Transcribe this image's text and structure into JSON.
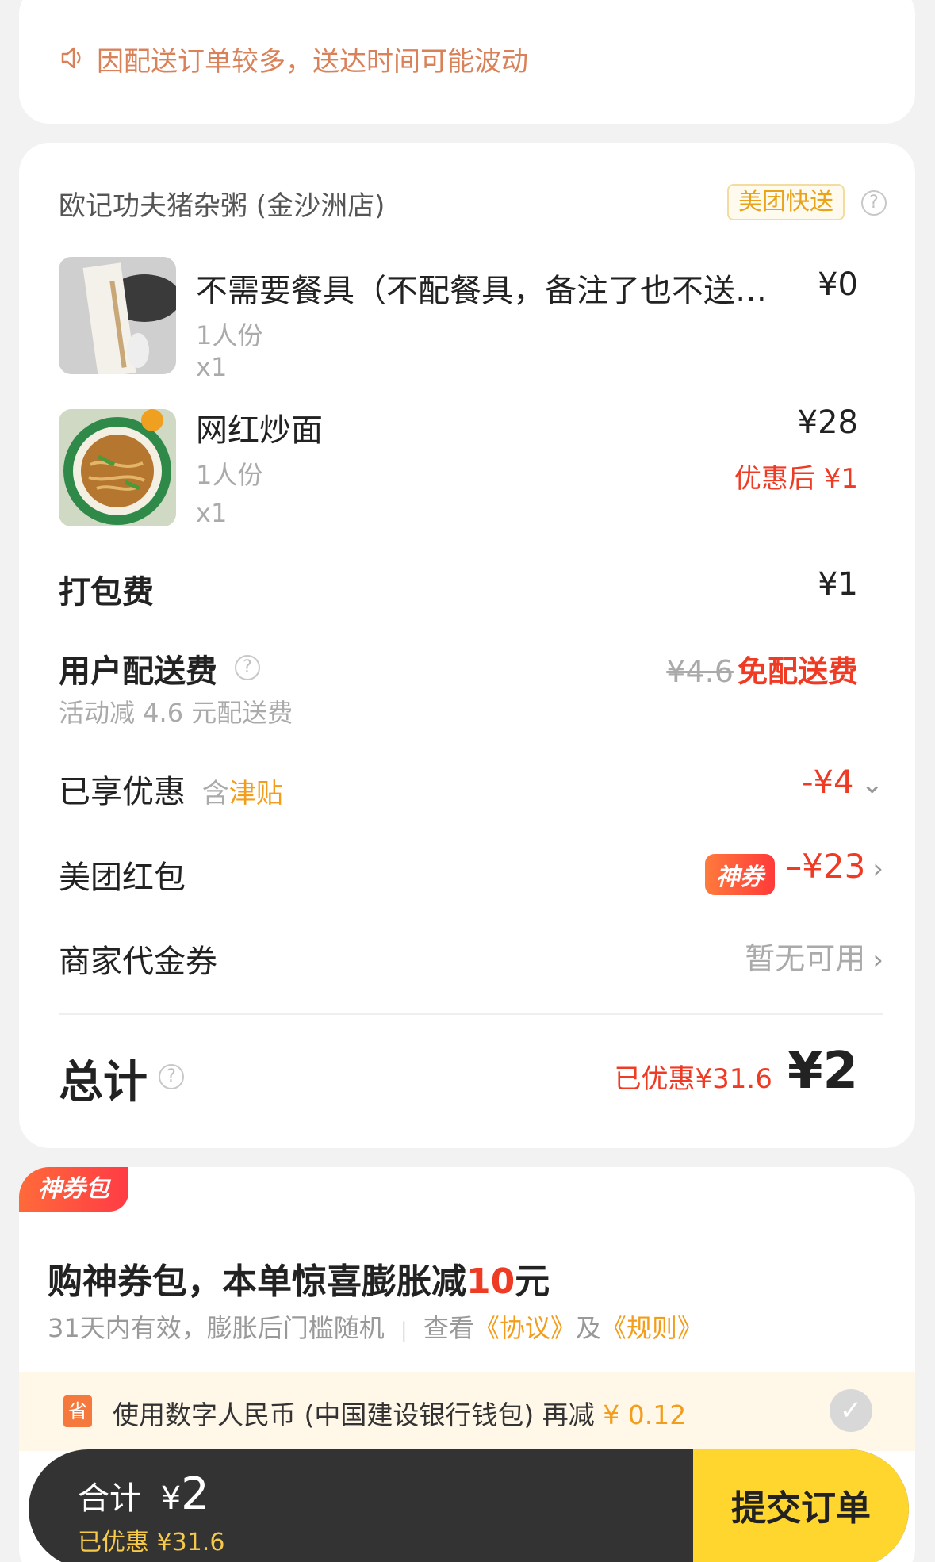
{
  "notice": {
    "icon": "speaker-icon",
    "text": "因配送订单较多，送达时间可能波动"
  },
  "order": {
    "shop_name": "欧记功夫猪杂粥 (金沙洲店)",
    "delivery_tag": "美团快送",
    "items": [
      {
        "name": "不需要餐具（不配餐具，备注了也不送…",
        "portion": "1人份",
        "qty": "x1",
        "price": "¥0"
      },
      {
        "name": "网红炒面",
        "portion": "1人份",
        "qty": "x1",
        "price": "¥28",
        "discount_price": "优惠后 ¥1"
      }
    ],
    "packing_fee": {
      "label": "打包费",
      "value": "¥1"
    },
    "delivery_fee": {
      "label": "用户配送费",
      "sub": "活动减 4.6 元配送费",
      "original": "¥4.6",
      "value": "免配送费"
    },
    "discount": {
      "label": "已享优惠",
      "tag_prefix": "含",
      "tag": "津贴",
      "value": "-¥4"
    },
    "red_packet": {
      "label": "美团红包",
      "badge": "神券",
      "value": "–¥23"
    },
    "merchant_coupon": {
      "label": "商家代金券",
      "value": "暂无可用"
    },
    "total": {
      "label": "总计",
      "saved": "已优惠¥31.6",
      "value": "¥2"
    }
  },
  "pack": {
    "badge": "神券包",
    "title_prefix": "购神券包，本单惊喜膨胀减",
    "title_amount": "10",
    "title_suffix": "元",
    "sub_text": "31天内有效，膨胀后门槛随机",
    "sub_sep": "|",
    "sub_view": "查看",
    "agreement": "《协议》",
    "and": "及",
    "rules": "《规则》",
    "digital_icon": "省",
    "digital_text": "使用数字人民币 (中国建设银行钱包) 再减",
    "digital_amount": "¥ 0.12"
  },
  "bottom": {
    "total_label": "合计",
    "currency": "¥",
    "total": "2",
    "saved": "已优惠 ¥31.6",
    "submit": "提交订单"
  },
  "colors": {
    "accent_red": "#ef3a24",
    "accent_orange": "#f29d1b",
    "submit_yellow": "#ffd62e"
  }
}
